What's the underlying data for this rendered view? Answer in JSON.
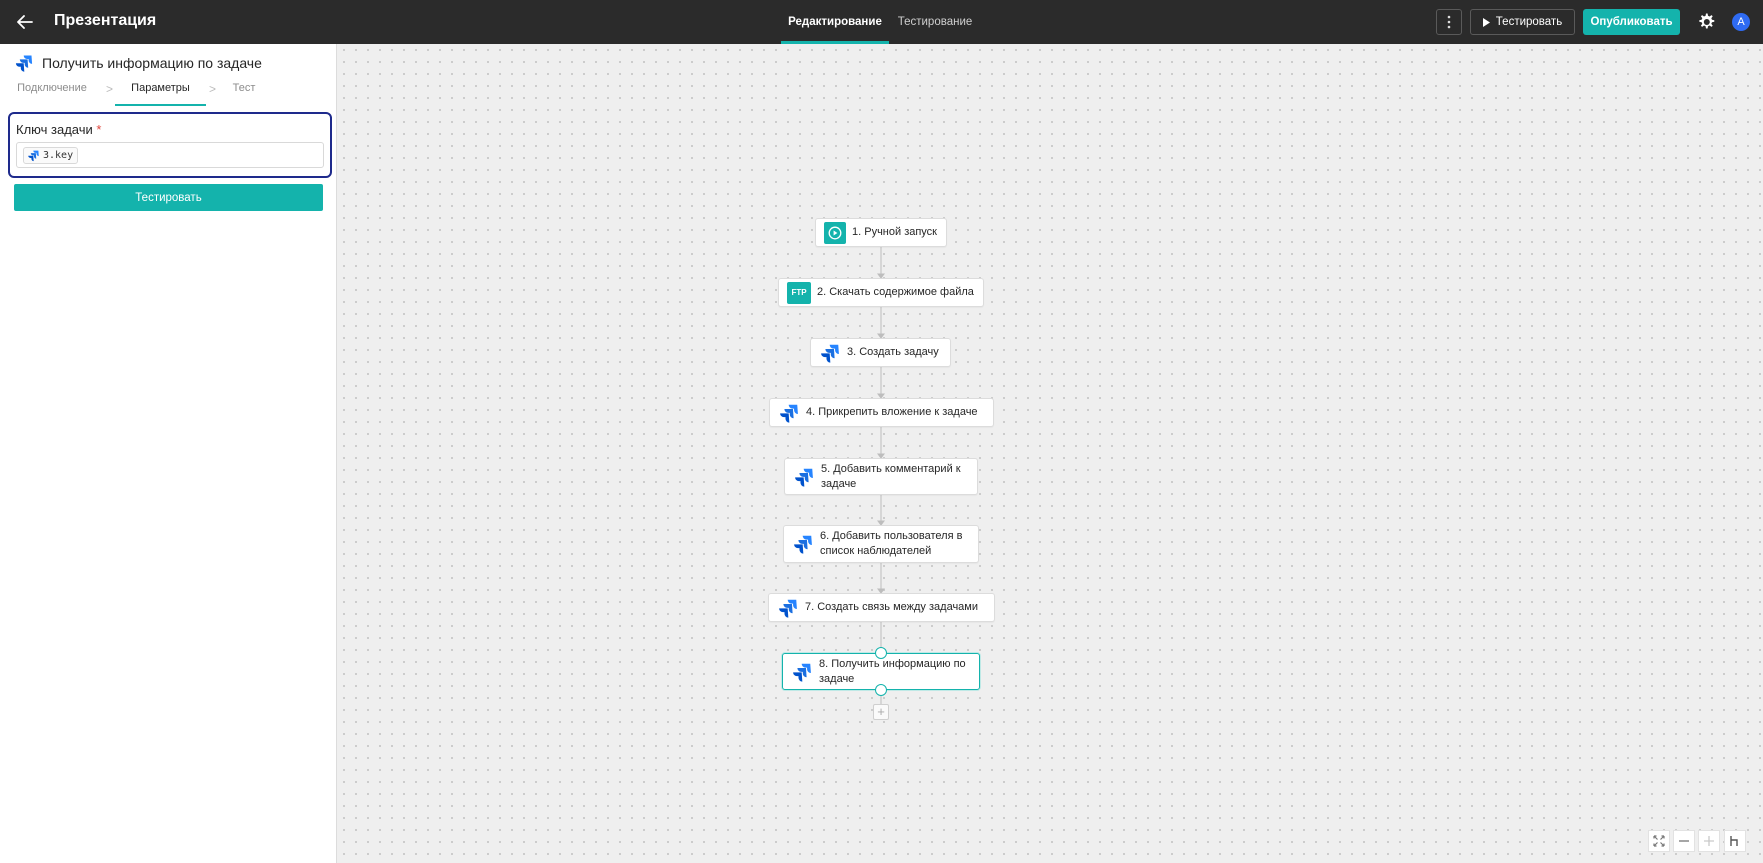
{
  "app": {
    "title": "Презентация"
  },
  "modes": [
    {
      "label": "Редактирование",
      "active": true
    },
    {
      "label": "Тестирование",
      "active": false
    }
  ],
  "toolbar": {
    "test_label": "Тестировать",
    "publish_label": "Опубликовать",
    "avatar_letter": "A",
    "accent": "#14b3ac"
  },
  "panel": {
    "title": "Получить информацию по задаче",
    "tabs": [
      {
        "label": "Подключение",
        "active": false
      },
      {
        "label": "Параметры",
        "active": true
      },
      {
        "label": "Тест",
        "active": false
      }
    ],
    "field": {
      "label": "Ключ задачи",
      "required_mark": "*",
      "chip_value": "3.key"
    },
    "test_button": "Тестировать"
  },
  "flow": {
    "steps": [
      {
        "label": "1. Ручной запуск",
        "icon": "play-icon"
      },
      {
        "label": "2. Скачать содержимое файла",
        "icon": "ftp-icon",
        "icon_text": "FTP"
      },
      {
        "label": "3. Создать задачу",
        "icon": "jira-icon"
      },
      {
        "label": "4. Прикрепить вложение к задаче",
        "icon": "jira-icon"
      },
      {
        "label": "5. Добавить комментарий к задаче",
        "icon": "jira-icon"
      },
      {
        "label": "6. Добавить пользователя в список наблюдателей",
        "icon": "jira-icon"
      },
      {
        "label": "7. Создать связь между задачами",
        "icon": "jira-icon"
      },
      {
        "label": "8. Получить информацию по задаче",
        "icon": "jira-icon",
        "selected": true
      }
    ],
    "add_symbol": "+"
  },
  "zoom_controls": [
    "fit-icon",
    "zoom-out-icon",
    "zoom-in-icon",
    "layout-icon"
  ]
}
